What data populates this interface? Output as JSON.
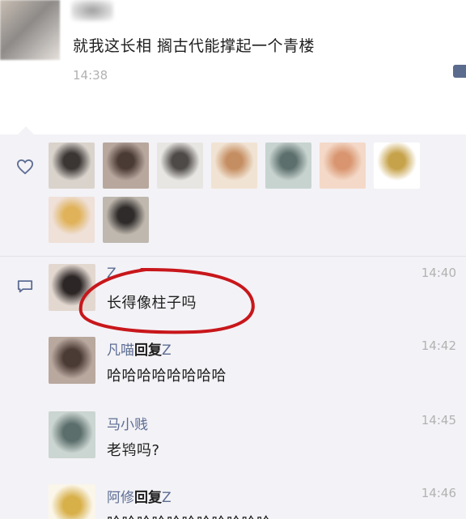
{
  "post": {
    "text": "就我这长相 搁古代能撑起一个青楼",
    "time": "14:38",
    "avatar_icon": "user-avatar-blurred"
  },
  "likes": {
    "icon": "heart-outline-icon",
    "avatars": [
      {
        "name": "liker-avatar-1",
        "colors": [
          "#d9d3cc",
          "#3b3534"
        ]
      },
      {
        "name": "liker-avatar-2",
        "colors": [
          "#b7a79d",
          "#4b3b35"
        ]
      },
      {
        "name": "liker-avatar-3",
        "colors": [
          "#e8e6e2",
          "#4d4a48"
        ]
      },
      {
        "name": "liker-avatar-4",
        "colors": [
          "#f1e3d3",
          "#c58e62"
        ]
      },
      {
        "name": "liker-avatar-5",
        "colors": [
          "#c7d3cf",
          "#5c6f6c"
        ]
      },
      {
        "name": "liker-avatar-6",
        "colors": [
          "#f4d9c8",
          "#d8956f"
        ]
      },
      {
        "name": "liker-avatar-7",
        "colors": [
          "#ffffff",
          "#c6a24a"
        ]
      },
      {
        "name": "liker-avatar-8",
        "colors": [
          "#efe0d8",
          "#e0b25a"
        ]
      },
      {
        "name": "liker-avatar-9",
        "colors": [
          "#bfb8ae",
          "#2e2b2a"
        ]
      }
    ]
  },
  "comments": {
    "icon": "comment-bubble-icon",
    "items": [
      {
        "name": "Z",
        "reply_word": "",
        "reply_to": "",
        "time": "14:40",
        "text": "长得像柱子吗",
        "avatar_colors": [
          "#e3d8d0",
          "#2c2626"
        ]
      },
      {
        "name": "凡喵",
        "reply_word": "回复",
        "reply_to": "Z",
        "time": "14:42",
        "text": "哈哈哈哈哈哈哈哈",
        "avatar_colors": [
          "#b9a89e",
          "#4b3b35"
        ]
      },
      {
        "name": "马小贱",
        "reply_word": "",
        "reply_to": "",
        "time": "14:45",
        "text": "老鸨吗?",
        "avatar_colors": [
          "#cbd5d1",
          "#5b6e6b"
        ]
      },
      {
        "name": "阿修",
        "reply_word": "回复",
        "reply_to": "Z",
        "time": "14:46",
        "text": "哈哈哈哈哈哈哈哈哈哈哈",
        "avatar_colors": [
          "#fbf6ea",
          "#d8b04a"
        ]
      }
    ]
  },
  "colors": {
    "name_link": "#5c6d93",
    "timestamp": "#b2b2b2",
    "panel_bg": "#f3f2f6",
    "annotation": "#c8171b"
  }
}
